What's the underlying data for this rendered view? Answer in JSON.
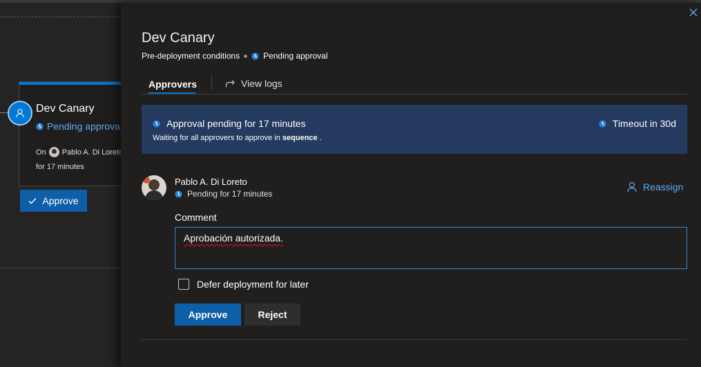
{
  "pipeline": {
    "stage": {
      "name": "Dev Canary",
      "status": "Pending approva",
      "on_label": "On",
      "approver": "Pablo A. Di Loreto",
      "duration": "for 17 minutes"
    },
    "approve_button": "Approve"
  },
  "panel": {
    "title": "Dev Canary",
    "breadcrumb": {
      "conditions": "Pre-deployment conditions",
      "status": "Pending approval"
    },
    "tabs": {
      "approvers": "Approvers",
      "view_logs": "View logs"
    },
    "banner": {
      "main": "Approval pending for 17 minutes",
      "sub_prefix": "Waiting for all approvers to approve in",
      "sub_bold": "sequence",
      "sub_suffix": ".",
      "timeout": "Timeout in 30d"
    },
    "approver": {
      "name": "Pablo A. Di Loreto",
      "status": "Pending for 17 minutes",
      "reassign": "Reassign"
    },
    "comment": {
      "label": "Comment",
      "value": "Aprobación autorizada."
    },
    "defer": {
      "label": "Defer deployment for later",
      "checked": false
    },
    "buttons": {
      "approve": "Approve",
      "reject": "Reject"
    }
  },
  "colors": {
    "accent": "#0078d4",
    "link": "#5eaaf5",
    "banner_bg": "#243a5e",
    "primary_button": "#0f5ea8",
    "panel_bg": "#201f1e"
  },
  "icons": {
    "close": "close-icon",
    "clock": "clock-icon",
    "view_logs": "redo-arrow-icon",
    "reassign": "person-icon",
    "check": "checkmark-icon"
  }
}
